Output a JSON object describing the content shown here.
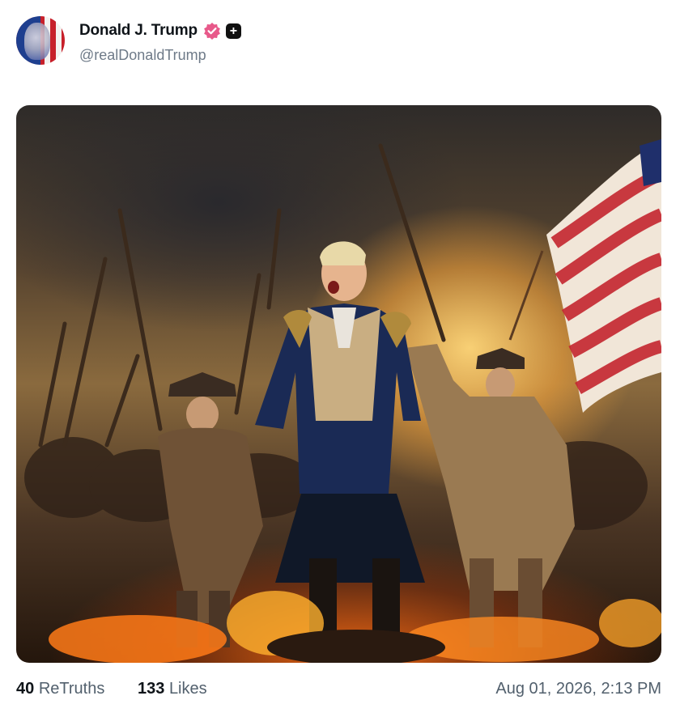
{
  "post": {
    "author": {
      "display_name": "Donald J. Trump",
      "handle": "@realDonaldTrump",
      "avatar_icon": "avatar-flag-portrait",
      "verified_icon": "verified-badge-icon",
      "verified_color": "#e8598a",
      "extra_badge_icon": "plus-square-icon",
      "extra_badge_glyph": "+"
    },
    "media": {
      "type": "image",
      "icon": "painting-image"
    },
    "stats": {
      "retruths_count": "40",
      "retruths_label": "ReTruths",
      "likes_count": "133",
      "likes_label": "Likes"
    },
    "timestamp": "Aug 01, 2026, 2:13 PM"
  }
}
